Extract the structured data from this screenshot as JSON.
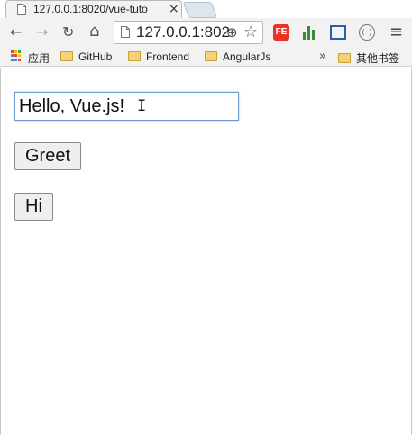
{
  "tab": {
    "title": "127.0.0.1:8020/vue-tuto",
    "close_glyph": "×"
  },
  "toolbar": {
    "back_glyph": "←",
    "forward_glyph": "→",
    "reload_glyph": "↻",
    "home_glyph": "⌂",
    "url": "127.0.0.1:8020",
    "zoom_glyph": "⊕",
    "star_glyph": "☆",
    "fe_label": "FE",
    "circle_label": "(··)",
    "menu_glyph": "≡"
  },
  "bookmarks": {
    "apps_label": "应用",
    "items": [
      "GitHub",
      "Frontend",
      "AngularJs"
    ],
    "overflow_glyph": "»",
    "other_label": "其他书签"
  },
  "page": {
    "message_value": "Hello, Vue.js!",
    "greet_label": "Greet",
    "hi_label": "Hi"
  },
  "colors": {
    "apps_grid": [
      "#e94335",
      "#fbbc05",
      "#34a853",
      "#4285f4",
      "#e94335",
      "#fbbc05",
      "#34a853",
      "#4285f4",
      "#e94335"
    ]
  }
}
